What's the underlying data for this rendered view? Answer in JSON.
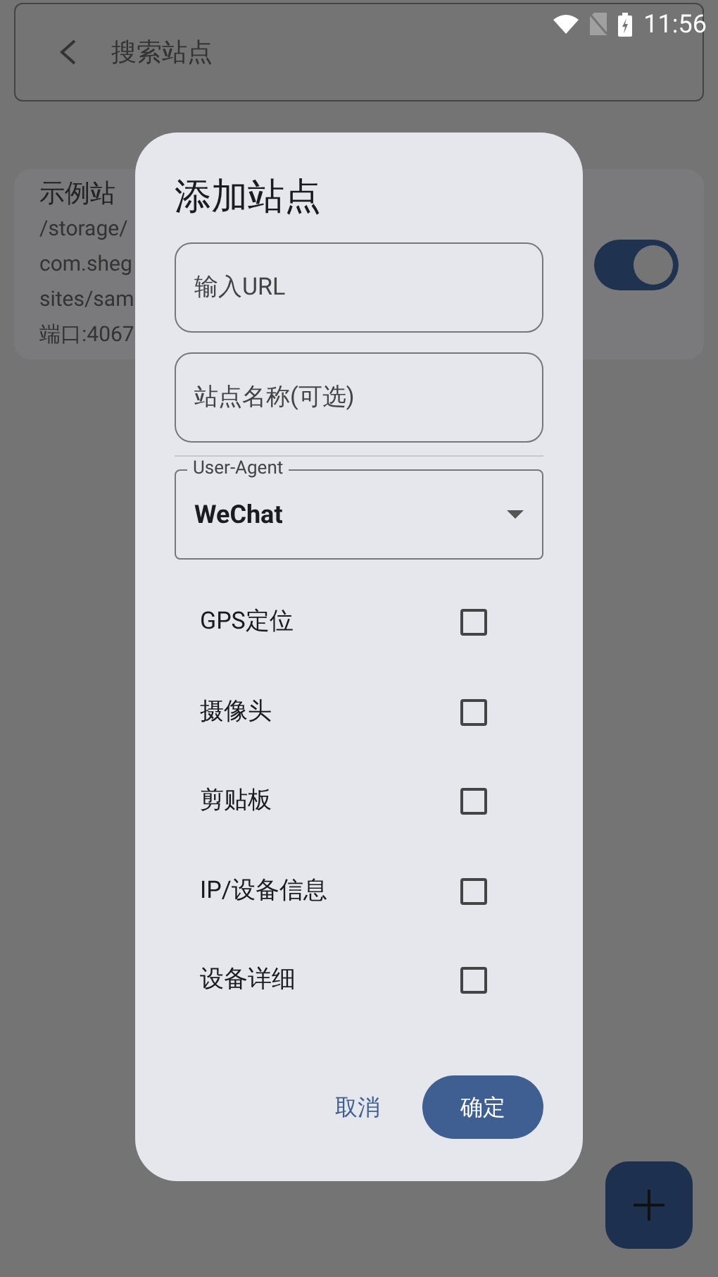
{
  "status_bar": {
    "time": "11:56"
  },
  "search": {
    "placeholder": "搜索站点"
  },
  "site_card": {
    "title": "示例站",
    "lines": [
      "/storage/",
      "com.sheg",
      "sites/sam",
      "端口:4067"
    ],
    "on": true
  },
  "dialog": {
    "title": "添加站点",
    "fields": [
      {
        "placeholder": "输入URL"
      },
      {
        "placeholder": "站点名称(可选)"
      }
    ],
    "user_agent": {
      "label": "User-Agent",
      "value": "WeChat"
    },
    "options": [
      {
        "label": "GPS定位",
        "checked": false
      },
      {
        "label": "摄像头",
        "checked": false
      },
      {
        "label": "剪贴板",
        "checked": false
      },
      {
        "label": "IP/设备信息",
        "checked": false
      },
      {
        "label": "设备详细",
        "checked": false
      }
    ],
    "cancel": "取消",
    "confirm": "确定"
  }
}
